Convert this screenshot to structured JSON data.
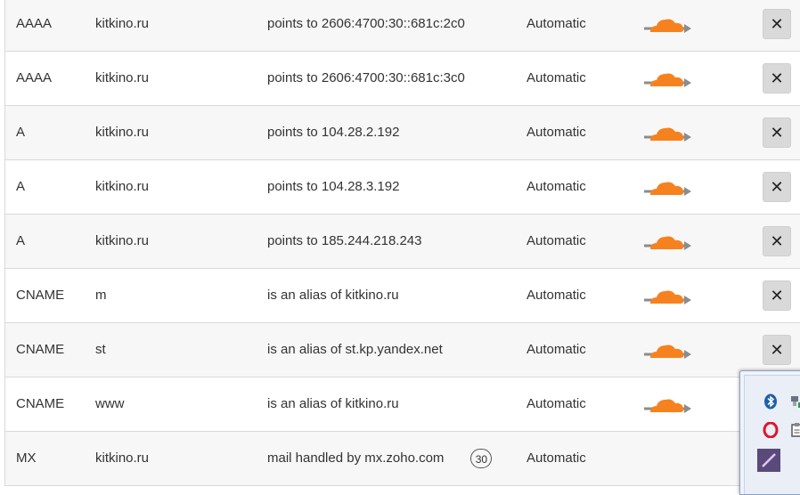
{
  "records": [
    {
      "type": "AAAA",
      "name": "kitkino.ru",
      "value": "points to 2606:4700:30::681c:2c0",
      "ttl": "Automatic",
      "proxied": true,
      "delete_label": "✕"
    },
    {
      "type": "AAAA",
      "name": "kitkino.ru",
      "value": "points to 2606:4700:30::681c:3c0",
      "ttl": "Automatic",
      "proxied": true,
      "delete_label": "✕"
    },
    {
      "type": "A",
      "name": "kitkino.ru",
      "value": "points to 104.28.2.192",
      "ttl": "Automatic",
      "proxied": true,
      "delete_label": "✕"
    },
    {
      "type": "A",
      "name": "kitkino.ru",
      "value": "points to 104.28.3.192",
      "ttl": "Automatic",
      "proxied": true,
      "delete_label": "✕"
    },
    {
      "type": "A",
      "name": "kitkino.ru",
      "value": "points to 185.244.218.243",
      "ttl": "Automatic",
      "proxied": true,
      "delete_label": "✕"
    },
    {
      "type": "CNAME",
      "name": "m",
      "value": "is an alias of kitkino.ru",
      "ttl": "Automatic",
      "proxied": true,
      "delete_label": "✕"
    },
    {
      "type": "CNAME",
      "name": "st",
      "value": "is an alias of st.kp.yandex.net",
      "ttl": "Automatic",
      "proxied": true,
      "delete_label": "✕"
    },
    {
      "type": "CNAME",
      "name": "www",
      "value": "is an alias of kitkino.ru",
      "ttl": "Automatic",
      "proxied": true,
      "delete_label": ""
    },
    {
      "type": "MX",
      "name": "kitkino.ru",
      "value": "mail handled by mx.zoho.com",
      "priority": "30",
      "ttl": "Automatic",
      "proxied": false,
      "delete_label": ""
    }
  ],
  "colors": {
    "cloud_orange": "#f6821f",
    "arrow_gray": "#8c8c8c",
    "row_alt_bg": "#f7f7f7",
    "delete_bg": "#d9d9d9",
    "border": "#d9d9d9"
  },
  "icons": {
    "proxy": "orange-cloud-icon",
    "delete": "close-icon",
    "tray": [
      "bluetooth-icon",
      "network-icon",
      "opera-icon",
      "clipboard-icon",
      "pen-icon"
    ]
  }
}
